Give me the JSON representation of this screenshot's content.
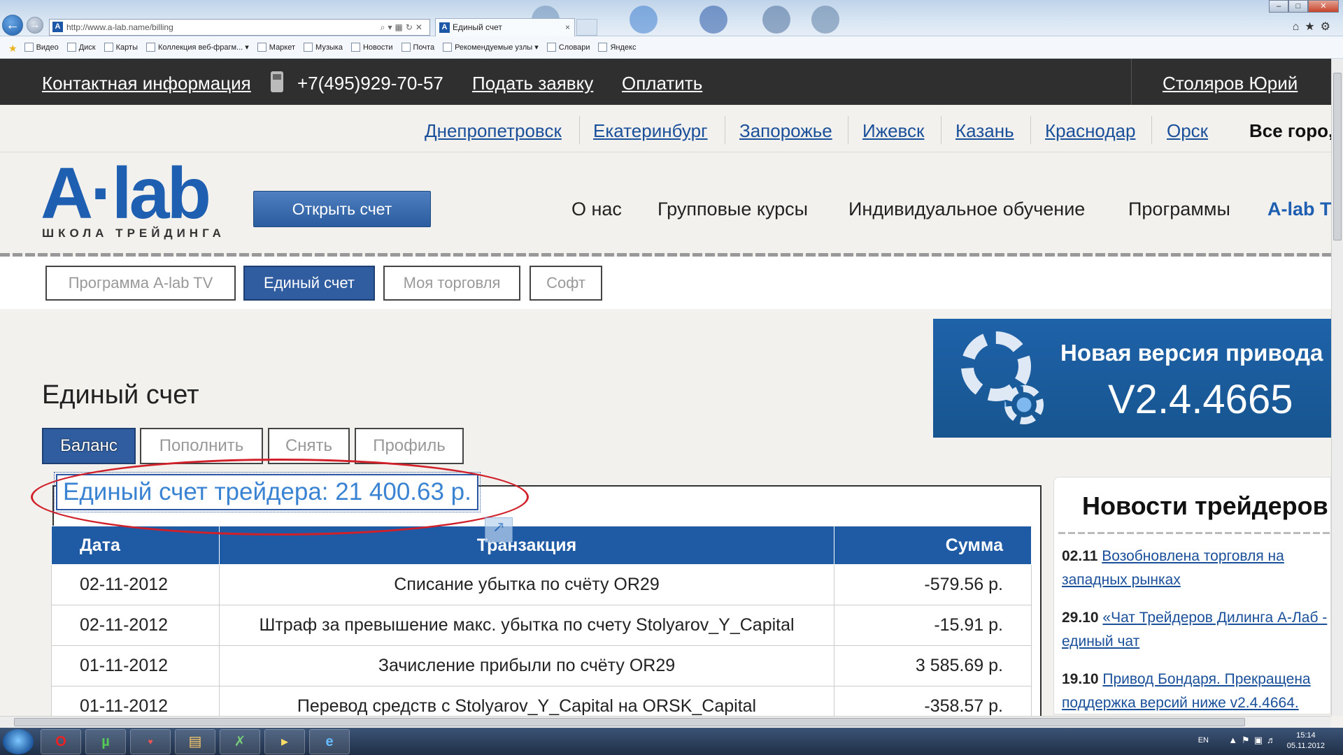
{
  "browser": {
    "url": "http://www.a-lab.name/billing",
    "tab_title": "Единый счет",
    "favorites": [
      "Видео",
      "Диск",
      "Карты",
      "Коллекция веб-фрагм...",
      "Маркет",
      "Музыка",
      "Новости",
      "Почта",
      "Рекомендуемые узлы",
      "Словари",
      "Яндекс"
    ]
  },
  "topbar": {
    "contact": "Контактная информация",
    "phone": "+7(495)929-70-57",
    "apply": "Подать заявку",
    "pay": "Оплатить",
    "user": "Столяров Юрий"
  },
  "cities": {
    "items": [
      "Днепропетровск",
      "Екатеринбург",
      "Запорожье",
      "Ижевск",
      "Казань",
      "Краснодар",
      "Орск"
    ],
    "all": "Все горо,"
  },
  "header": {
    "logo": "A·lab",
    "logo_sub": "ШКОЛА ТРЕЙДИНГА",
    "open_account": "Открыть счет",
    "menu": [
      "О нас",
      "Групповые курсы",
      "Индивидуальное обучение",
      "Программы",
      "A-lab T"
    ]
  },
  "subnav": {
    "tabs": [
      "Программа A-lab TV",
      "Единый счет",
      "Моя торговля",
      "Софт"
    ]
  },
  "main": {
    "title": "Единый счет",
    "tabs": [
      "Баланс",
      "Пополнить",
      "Снять",
      "Профиль"
    ],
    "balance": "Единый счет трейдера: 21 400.63 р.",
    "table": {
      "headers": [
        "Дата",
        "Транзакция",
        "Сумма"
      ],
      "rows": [
        [
          "02-11-2012",
          "Списание убытка по счёту OR29",
          "-579.56 р."
        ],
        [
          "02-11-2012",
          "Штраф за превышение макс. убытка по счету Stolyarov_Y_Capital",
          "-15.91 р."
        ],
        [
          "01-11-2012",
          "Зачисление прибыли по счёту OR29",
          "3 585.69 р."
        ],
        [
          "01-11-2012",
          "Перевод средств с Stolyarov_Y_Capital на ORSK_Capital",
          "-358.57 р."
        ]
      ]
    }
  },
  "promo": {
    "title": "Новая версия привода",
    "version": "V2.4.4665"
  },
  "news": {
    "title": "Новости трейдеров",
    "items": [
      {
        "date": "02.11",
        "text": "Возобновлена торговля на западных рынках"
      },
      {
        "date": "29.10",
        "text": "«Чат Трейдеров Дилинга А-Лаб - единый чат"
      },
      {
        "date": "19.10",
        "text": "Привод Бондаря. Прекращена поддержка версий ниже v2.4.4664."
      }
    ]
  },
  "taskbar": {
    "lang": "EN",
    "time": "15:14",
    "date": "05.11.2012"
  }
}
